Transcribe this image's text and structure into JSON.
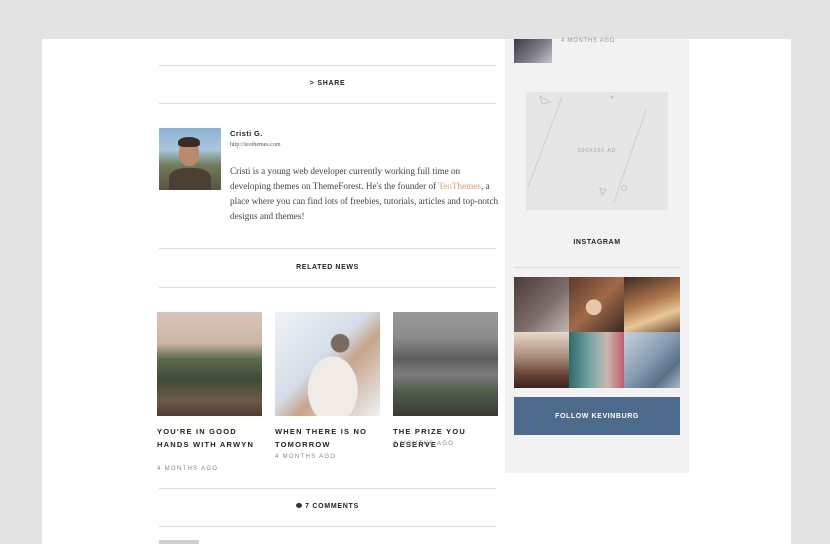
{
  "sidebar_top_post": {
    "date": "4 MONTHS AGO"
  },
  "share": {
    "icon": "share-icon",
    "label": "SHARE"
  },
  "author": {
    "name": "Cristi G.",
    "url": "http://teothemes.com",
    "bio_before": "Cristi is a young web developer currently working full time on developing themes on ThemeForest. He's the founder of ",
    "bio_link": "TeoThemes",
    "bio_after": ", a place where you can find lots of freebies, tutorials, articles and top-notch designs and themes!",
    "link_color": "#d8a06a"
  },
  "related": {
    "heading": "RELATED NEWS",
    "items": [
      {
        "title": "YOU'RE IN GOOD HANDS WITH ARWYN",
        "date": "4 MONTHS AGO"
      },
      {
        "title": "WHEN THERE IS NO TOMORROW",
        "date": "4 MONTHS AGO"
      },
      {
        "title": "THE PRIZE YOU DESERVE",
        "date": "4 MONTHS AGO"
      }
    ]
  },
  "ad": {
    "label": "300x250 AD"
  },
  "instagram": {
    "heading": "INSTAGRAM",
    "follow_label": "FOLLOW KEVINBURG",
    "button_color": "#4c6a8c"
  },
  "comments": {
    "icon": "comment-icon",
    "label": "7 COMMENTS"
  }
}
